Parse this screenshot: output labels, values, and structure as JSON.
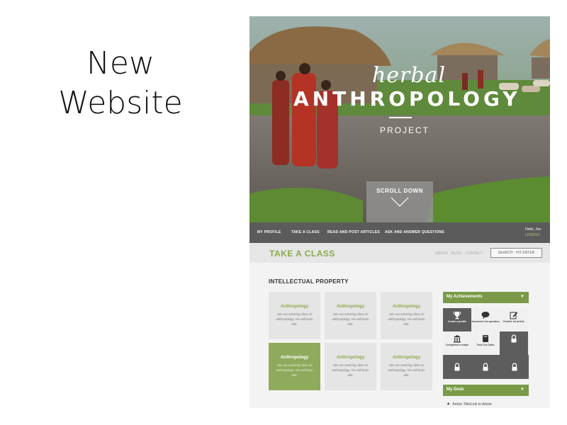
{
  "slide": {
    "title_line1": "New",
    "title_line2": "Website"
  },
  "hero": {
    "brand_script": "herbal",
    "brand_main": "ANTHROPOLOGY",
    "brand_sub": "PROJECT",
    "scroll_label": "SCROLL DOWN"
  },
  "nav": {
    "items": [
      "MY PROFILE",
      "TAKE A CLASS",
      "READ AND POST ARTICLES",
      "ASK AND ANSWER QUESTIONS"
    ],
    "greeting": "Hello, Joe",
    "logout": "LOGOUT"
  },
  "page": {
    "title": "TAKE A CLASS",
    "links": [
      "EBOOK",
      "BLOG",
      "CONTACT"
    ],
    "search_placeholder": "SEARCH - HIT ENTER"
  },
  "section": {
    "title": "INTELLECTUAL PROPERTY"
  },
  "cards": [
    {
      "title": "Anthropology",
      "body": "Join our amazing class on anthropology. You will learn alot."
    },
    {
      "title": "Anthropology",
      "body": "Join our amazing class on anthropology. You will learn alot."
    },
    {
      "title": "Anthropology",
      "body": "Join our amazing class on anthropology. You will learn alot."
    },
    {
      "title": "Anthropology",
      "body": "Join our amazing class on anthropology. You will learn alot.",
      "active": true
    },
    {
      "title": "Anthropology",
      "body": "Join our amazing class on anthropology. You will learn alot."
    },
    {
      "title": "Anthropology",
      "body": "Join our amazing class on anthropology. You will learn alot."
    }
  ],
  "achievements": {
    "title": "My Achievements",
    "caret": "▼",
    "badges": [
      {
        "label": "Create a profile",
        "icon": "trophy-icon"
      },
      {
        "label": "Answered 1st question",
        "icon": "speech-bubble-icon"
      },
      {
        "label": "Posted 1st article",
        "icon": "edit-icon"
      },
      {
        "label": "Completed a major",
        "icon": "institution-icon"
      },
      {
        "label": "Took 1st Class",
        "icon": "book-icon"
      },
      {
        "label": "",
        "icon": "lock-icon"
      },
      {
        "label": "",
        "icon": "lock-icon"
      },
      {
        "label": "",
        "icon": "lock-icon"
      },
      {
        "label": "",
        "icon": "lock-icon"
      }
    ]
  },
  "desk": {
    "title": "My Desk",
    "caret": "▼",
    "item": "Article Title/Link to Article"
  },
  "colors": {
    "accent_green": "#8aab4a",
    "panel_green": "#7a9a48",
    "nav_gray": "#5b5b5b"
  }
}
